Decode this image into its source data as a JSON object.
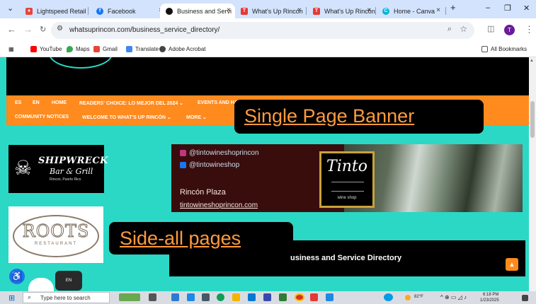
{
  "browser": {
    "tabs": [
      {
        "label": "Lightspeed Retail",
        "icon": "lightspeed-flame-icon",
        "color": "#e8453c"
      },
      {
        "label": "Facebook",
        "icon": "facebook-icon",
        "color": "#1877f2"
      },
      {
        "label": "Business and Servi",
        "icon": "site-favicon-icon",
        "color": "#111111",
        "active": true
      },
      {
        "label": "What's Up Rincón",
        "icon": "t-icon",
        "color": "#e53935"
      },
      {
        "label": "What's Up Rincón",
        "icon": "t-icon",
        "color": "#e53935"
      },
      {
        "label": "Home - Canva",
        "icon": "canva-icon",
        "color": "#00b4d8"
      }
    ],
    "url": "whatsuprincon.com/business_service_directory/",
    "profile_initial": "T",
    "bookmarks": [
      {
        "label": "YouTube",
        "icon": "youtube-icon",
        "color": "#ff0000"
      },
      {
        "label": "Maps",
        "icon": "maps-icon",
        "color": "#34a853"
      },
      {
        "label": "Gmail",
        "icon": "gmail-icon",
        "color": "#ea4335"
      },
      {
        "label": "Translate",
        "icon": "translate-icon",
        "color": "#4285f4"
      },
      {
        "label": "Adobe Acrobat",
        "icon": "acrobat-icon",
        "color": "#444444"
      }
    ],
    "all_bookmarks": "All Bookmarks"
  },
  "site": {
    "nav_row1": [
      "ES",
      "EN",
      "HOME",
      "READERS' CHOICE: LO MEJOR DEL 2024 ⌄",
      "EVENTS AND HA"
    ],
    "nav_row2": [
      "COMMUNITY NOTICES",
      "WELCOME TO WHAT'S UP RINCÓN ⌄",
      "MORE ⌄"
    ],
    "shipwreck": {
      "name": "SHIPWRECK",
      "sub": "Bar & Grill",
      "location": "Rincon, Puerto Rico"
    },
    "roots": {
      "name": "ROOTS",
      "sub": "RESTAURANT"
    },
    "tinto_ad": {
      "instagram": "@tintowineshoprincon",
      "facebook": "@tintowineshop",
      "plaza": "Rincón Plaza",
      "website": "tintowineshoprincon.com",
      "logo_text": "Tinto",
      "logo_sub": "wine shop"
    },
    "directory_title": "usiness and Service Directory",
    "lang_pill": "EN"
  },
  "annotations": {
    "banner": "Single Page Banner",
    "side": "Side-all pages"
  },
  "taskbar": {
    "search_placeholder": "Type here to search",
    "weather": "82°F",
    "time": "6:18 PM",
    "date": "1/23/2025"
  }
}
